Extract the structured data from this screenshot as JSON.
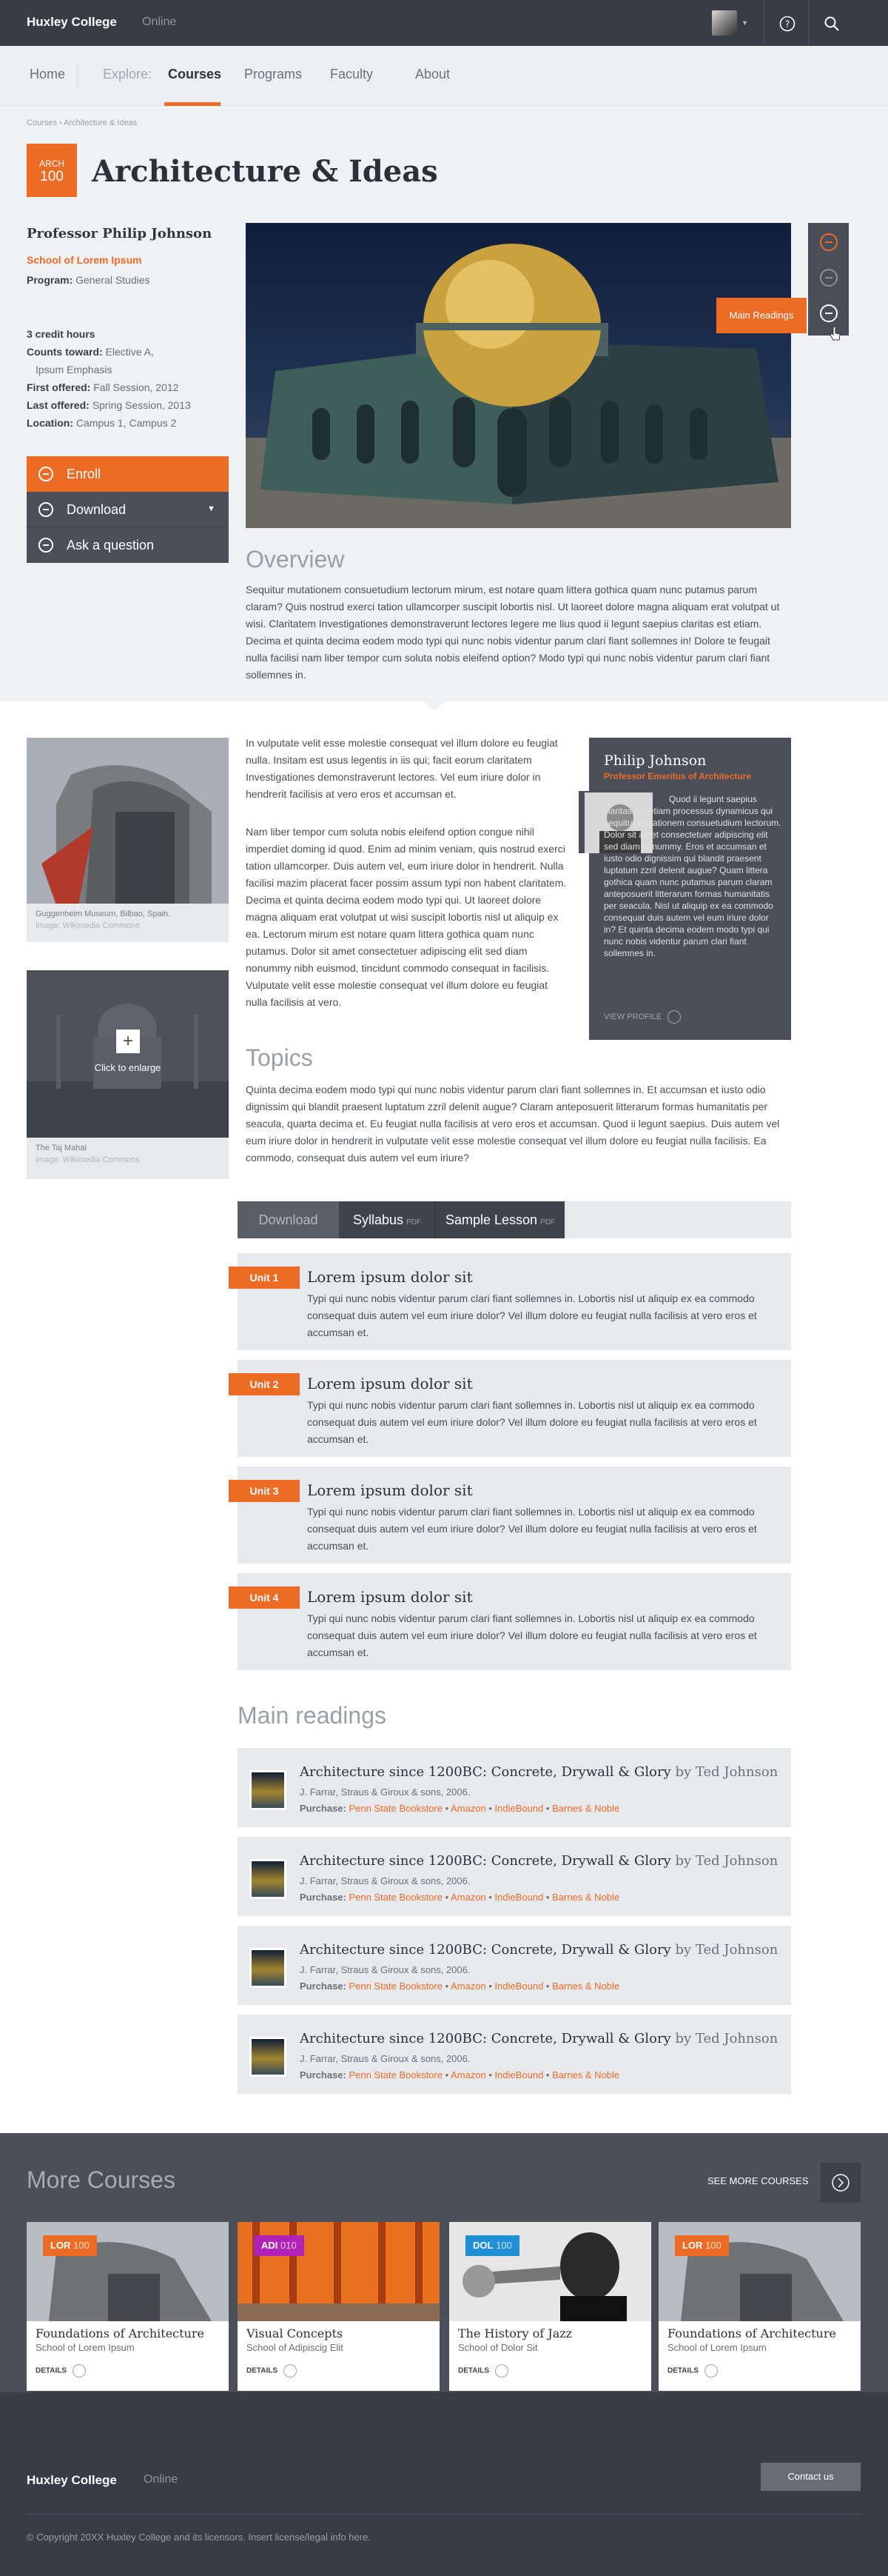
{
  "header": {
    "brand": "Huxley College",
    "brand_sub": "Online",
    "icons": [
      "user-avatar",
      "help-icon",
      "search-icon"
    ]
  },
  "nav": {
    "items": [
      {
        "label": "Home"
      },
      {
        "label": "Explore:"
      },
      {
        "label": "Courses",
        "active": true
      },
      {
        "label": "Programs"
      },
      {
        "label": "Faculty"
      },
      {
        "label": "About"
      }
    ]
  },
  "breadcrumb": "Courses › Architecture & Ideas",
  "course": {
    "code_prefix": "ARCH",
    "code_number": "100",
    "title": "Architecture & Ideas",
    "professor": "Professor Philip Johnson",
    "school": "School of Lorem Ipsum",
    "program_label": "Program:",
    "program": "General Studies",
    "credits": "3 credit hours",
    "counts_toward_label": "Counts toward:",
    "counts_toward_1": "Elective A,",
    "counts_toward_2": "Ipsum Emphasis",
    "first_offered_label": "First offered:",
    "first_offered": "Fall Session, 2012",
    "last_offered_label": "Last offered:",
    "last_offered": "Spring Session, 2013",
    "location_label": "Location:",
    "location": "Campus 1, Campus 2"
  },
  "actions": {
    "enroll": "Enroll",
    "download": "Download",
    "ask": "Ask a question"
  },
  "tooltip": "Main Readings",
  "overview": {
    "heading": "Overview",
    "text": "Sequitur mutationem consuetudium lectorum mirum, est notare quam littera gothica quam nunc putamus parum claram? Quis nostrud exerci tation ullamcorper suscipit lobortis nisl. Ut laoreet dolore magna aliquam erat volutpat ut wisi. Claritatem Investigationes demonstraverunt lectores legere me lius quod ii legunt saepius claritas est etiam. Decima et quinta decima eodem modo typi qui nunc nobis videntur parum clari fiant sollemnes in! Dolore te feugait nulla facilisi nam liber tempor cum soluta nobis eleifend option? Modo typi qui nunc nobis videntur parum clari fiant sollemnes in."
  },
  "body": {
    "p1": "In vulputate velit esse molestie consequat vel illum dolore eu feugiat nulla. Insitam est usus legentis in iis qui; facit eorum claritatem Investigationes demonstraverunt lectores. Vel eum iriure dolor in hendrerit facilisis at vero eros et accumsan et.",
    "p2": "Nam liber tempor cum soluta nobis eleifend option congue nihil imperdiet doming id quod. Enim ad minim veniam, quis nostrud exerci tation ullamcorper. Duis autem vel, eum iriure dolor in hendrerit. Nulla facilisi mazim placerat facer possim assum typi non habent claritatem. Decima et quinta decima eodem modo typi qui. Ut laoreet dolore magna aliquam erat volutpat ut wisi suscipit lobortis nisl ut aliquip ex ea. Lectorum mirum est notare quam littera gothica quam nunc putamus. Dolor sit amet consectetuer adipiscing elit sed diam nonummy nibh euismod, tincidunt commodo consequat in facilisis. Vulputate velit esse molestie consequat vel illum dolore eu feugiat nulla facilisis at vero."
  },
  "images": [
    {
      "caption": "Guggenheim Museum, Bilbao, Spain.",
      "credit": "Image: Wikimedia Commons"
    },
    {
      "caption": "The Taj Mahal",
      "credit": "Image: Wikimedia Commons",
      "overlay": "Click to enlarge"
    }
  ],
  "profile": {
    "name": "Philip Johnson",
    "title": "Professor Emeritus of Architecture",
    "bio": "Quod ii legunt saepius claritas est etiam processus dynamicus qui sequitur mutationem consuetudium lectorum. Dolor sit amet consectetuer adipiscing elit sed diam nonummy. Eros et accumsan et iusto odio dignissim qui blandit praesent luptatum zzril delenit augue? Quam littera gothica quam nunc putamus parum claram anteposuerit litterarum formas humanitatis per seacula. Nisl ut aliquip ex ea commodo consequat duis autem vel eum iriure dolor in? Et quinta decima eodem modo typi qui nunc nobis videntur parum clari fiant sollemnes in.",
    "view": "VIEW PROFILE"
  },
  "topics": {
    "heading": "Topics",
    "text": "Quinta decima eodem modo typi qui nunc nobis videntur parum clari fiant sollemnes in. Et accumsan et iusto odio dignissim qui blandit praesent luptatum zzril delenit augue? Claram anteposuerit litterarum formas humanitatis per seacula, quarta decima et. Eu feugiat nulla facilisis at vero eros et accumsan. Quod ii legunt saepius. Duis autem vel eum iriure dolor in hendrerit in vulputate velit esse molestie consequat vel illum dolore eu feugiat nulla facilisis. Ea commodo, consequat duis autem vel eum iriure?"
  },
  "tabs": [
    {
      "label": "Download",
      "sub": ""
    },
    {
      "label": "Syllabus",
      "sub": "PDF"
    },
    {
      "label": "Sample Lesson",
      "sub": "PDF"
    }
  ],
  "units": [
    {
      "tag": "Unit 1",
      "title": "Lorem ipsum dolor sit",
      "text": "Typi qui nunc nobis videntur parum clari fiant sollemnes in. Lobortis nisl ut aliquip ex ea commodo consequat duis autem vel eum iriure dolor? Vel illum dolore eu feugiat nulla facilisis at vero eros et accumsan et."
    },
    {
      "tag": "Unit 2",
      "title": "Lorem ipsum dolor sit",
      "text": "Typi qui nunc nobis videntur parum clari fiant sollemnes in. Lobortis nisl ut aliquip ex ea commodo consequat duis autem vel eum iriure dolor? Vel illum dolore eu feugiat nulla facilisis at vero eros et accumsan et."
    },
    {
      "tag": "Unit 3",
      "title": "Lorem ipsum dolor sit",
      "text": "Typi qui nunc nobis videntur parum clari fiant sollemnes in. Lobortis nisl ut aliquip ex ea commodo consequat duis autem vel eum iriure dolor? Vel illum dolore eu feugiat nulla facilisis at vero eros et accumsan et."
    },
    {
      "tag": "Unit 4",
      "title": "Lorem ipsum dolor sit",
      "text": "Typi qui nunc nobis videntur parum clari fiant sollemnes in. Lobortis nisl ut aliquip ex ea commodo consequat duis autem vel eum iriure dolor? Vel illum dolore eu feugiat nulla facilisis at vero eros et accumsan et."
    }
  ],
  "readings": {
    "heading": "Main readings",
    "items": [
      {
        "title": "Architecture since 1200BC: Concrete, Drywall & Glory",
        "by": "by Ted Johnson",
        "publisher": "J. Farrar, Straus & Giroux & sons, 2006.",
        "purchase_label": "Purchase:",
        "stores": [
          "Penn State Bookstore",
          "Amazon",
          "IndieBound",
          "Barnes & Noble"
        ]
      },
      {
        "title": "Architecture since 1200BC: Concrete, Drywall & Glory",
        "by": "by Ted Johnson",
        "publisher": "J. Farrar, Straus & Giroux & sons, 2006.",
        "purchase_label": "Purchase:",
        "stores": [
          "Penn State Bookstore",
          "Amazon",
          "IndieBound",
          "Barnes & Noble"
        ]
      },
      {
        "title": "Architecture since 1200BC: Concrete, Drywall & Glory",
        "by": "by Ted Johnson",
        "publisher": "J. Farrar, Straus & Giroux & sons, 2006.",
        "purchase_label": "Purchase:",
        "stores": [
          "Penn State Bookstore",
          "Amazon",
          "IndieBound",
          "Barnes & Noble"
        ]
      },
      {
        "title": "Architecture since 1200BC: Concrete, Drywall & Glory",
        "by": "by Ted Johnson",
        "publisher": "J. Farrar, Straus & Giroux & sons, 2006.",
        "purchase_label": "Purchase:",
        "stores": [
          "Penn State Bookstore",
          "Amazon",
          "IndieBound",
          "Barnes & Noble"
        ]
      }
    ]
  },
  "more_courses": {
    "heading": "More Courses",
    "see_more": "SEE MORE COURSES",
    "cards": [
      {
        "code": "LOR",
        "num": "100",
        "tag_color": "#ec6c26",
        "name": "Foundations of Architecture",
        "school": "School of Lorem Ipsum",
        "details": "DETAILS"
      },
      {
        "code": "ADI",
        "num": "010",
        "tag_color": "#b322b8",
        "name": "Visual Concepts",
        "school": "School of Adipiscig Elit",
        "details": "DETAILS"
      },
      {
        "code": "DOL",
        "num": "100",
        "tag_color": "#1f8fd6",
        "name": "The History of Jazz",
        "school": "School of Dolor Sit",
        "details": "DETAILS"
      },
      {
        "code": "LOR",
        "num": "100",
        "tag_color": "#ec6c26",
        "name": "Foundations of Architecture",
        "school": "School of Lorem Ipsum",
        "details": "DETAILS"
      }
    ]
  },
  "footer": {
    "brand": "Huxley College",
    "brand_sub": "Online",
    "contact": "Contact us",
    "copyright": "© Copyright 20XX Huxley College and its licensors. Insert license/legal info here."
  },
  "colors": {
    "accent": "#ec6c26",
    "dark": "#383c47",
    "panel": "#4b4f59",
    "light": "#e7e9ed"
  }
}
